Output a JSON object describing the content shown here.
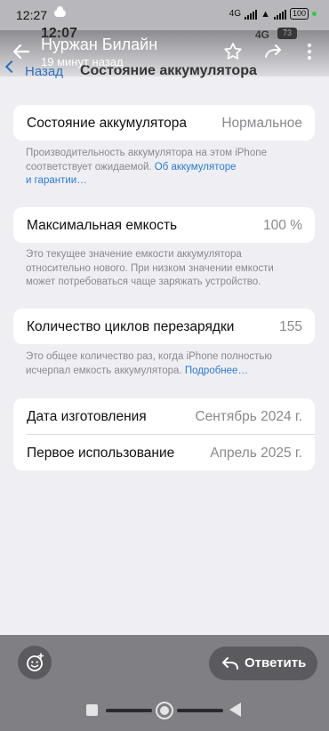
{
  "status_bar": {
    "time": "12:27",
    "network": "4G",
    "battery": "100"
  },
  "embedded": {
    "ios_time": "12:07",
    "ios_network": "4G",
    "ios_battery": "73",
    "nav_back": "Назад",
    "nav_title": "Состояние аккумулятора"
  },
  "viewer": {
    "sender": "Нуржан Билайн",
    "time_ago": "19 минут назад"
  },
  "battery_health": {
    "label": "Состояние аккумулятора",
    "value": "Нормальное"
  },
  "note1": {
    "line1": "Производительность аккумулятора на этом iPhone",
    "line2_text": "соответствует ожидаемой. ",
    "line2_link": "Об аккумуляторе",
    "line3_link": "и гарантии…"
  },
  "max_capacity": {
    "label": "Максимальная емкость",
    "value": "100 %"
  },
  "note2": {
    "line1": "Это текущее значение емкости аккумулятора",
    "line2": "относительно нового. При низком значении емкости",
    "line3": "может потребоваться чаще заряжать устройство."
  },
  "cycle_count": {
    "label": "Количество циклов перезарядки",
    "value": "155"
  },
  "note3": {
    "line1": "Это общее количество раз, когда iPhone полностью",
    "line2_text": "исчерпал емкость аккумулятора. ",
    "line2_link": "Подробнее…"
  },
  "manufacture": {
    "label": "Дата изготовления",
    "value": "Сентябрь 2024 г."
  },
  "first_use": {
    "label": "Первое использование",
    "value": "Апрель 2025 г."
  },
  "actions": {
    "reply_label": "Ответить"
  }
}
